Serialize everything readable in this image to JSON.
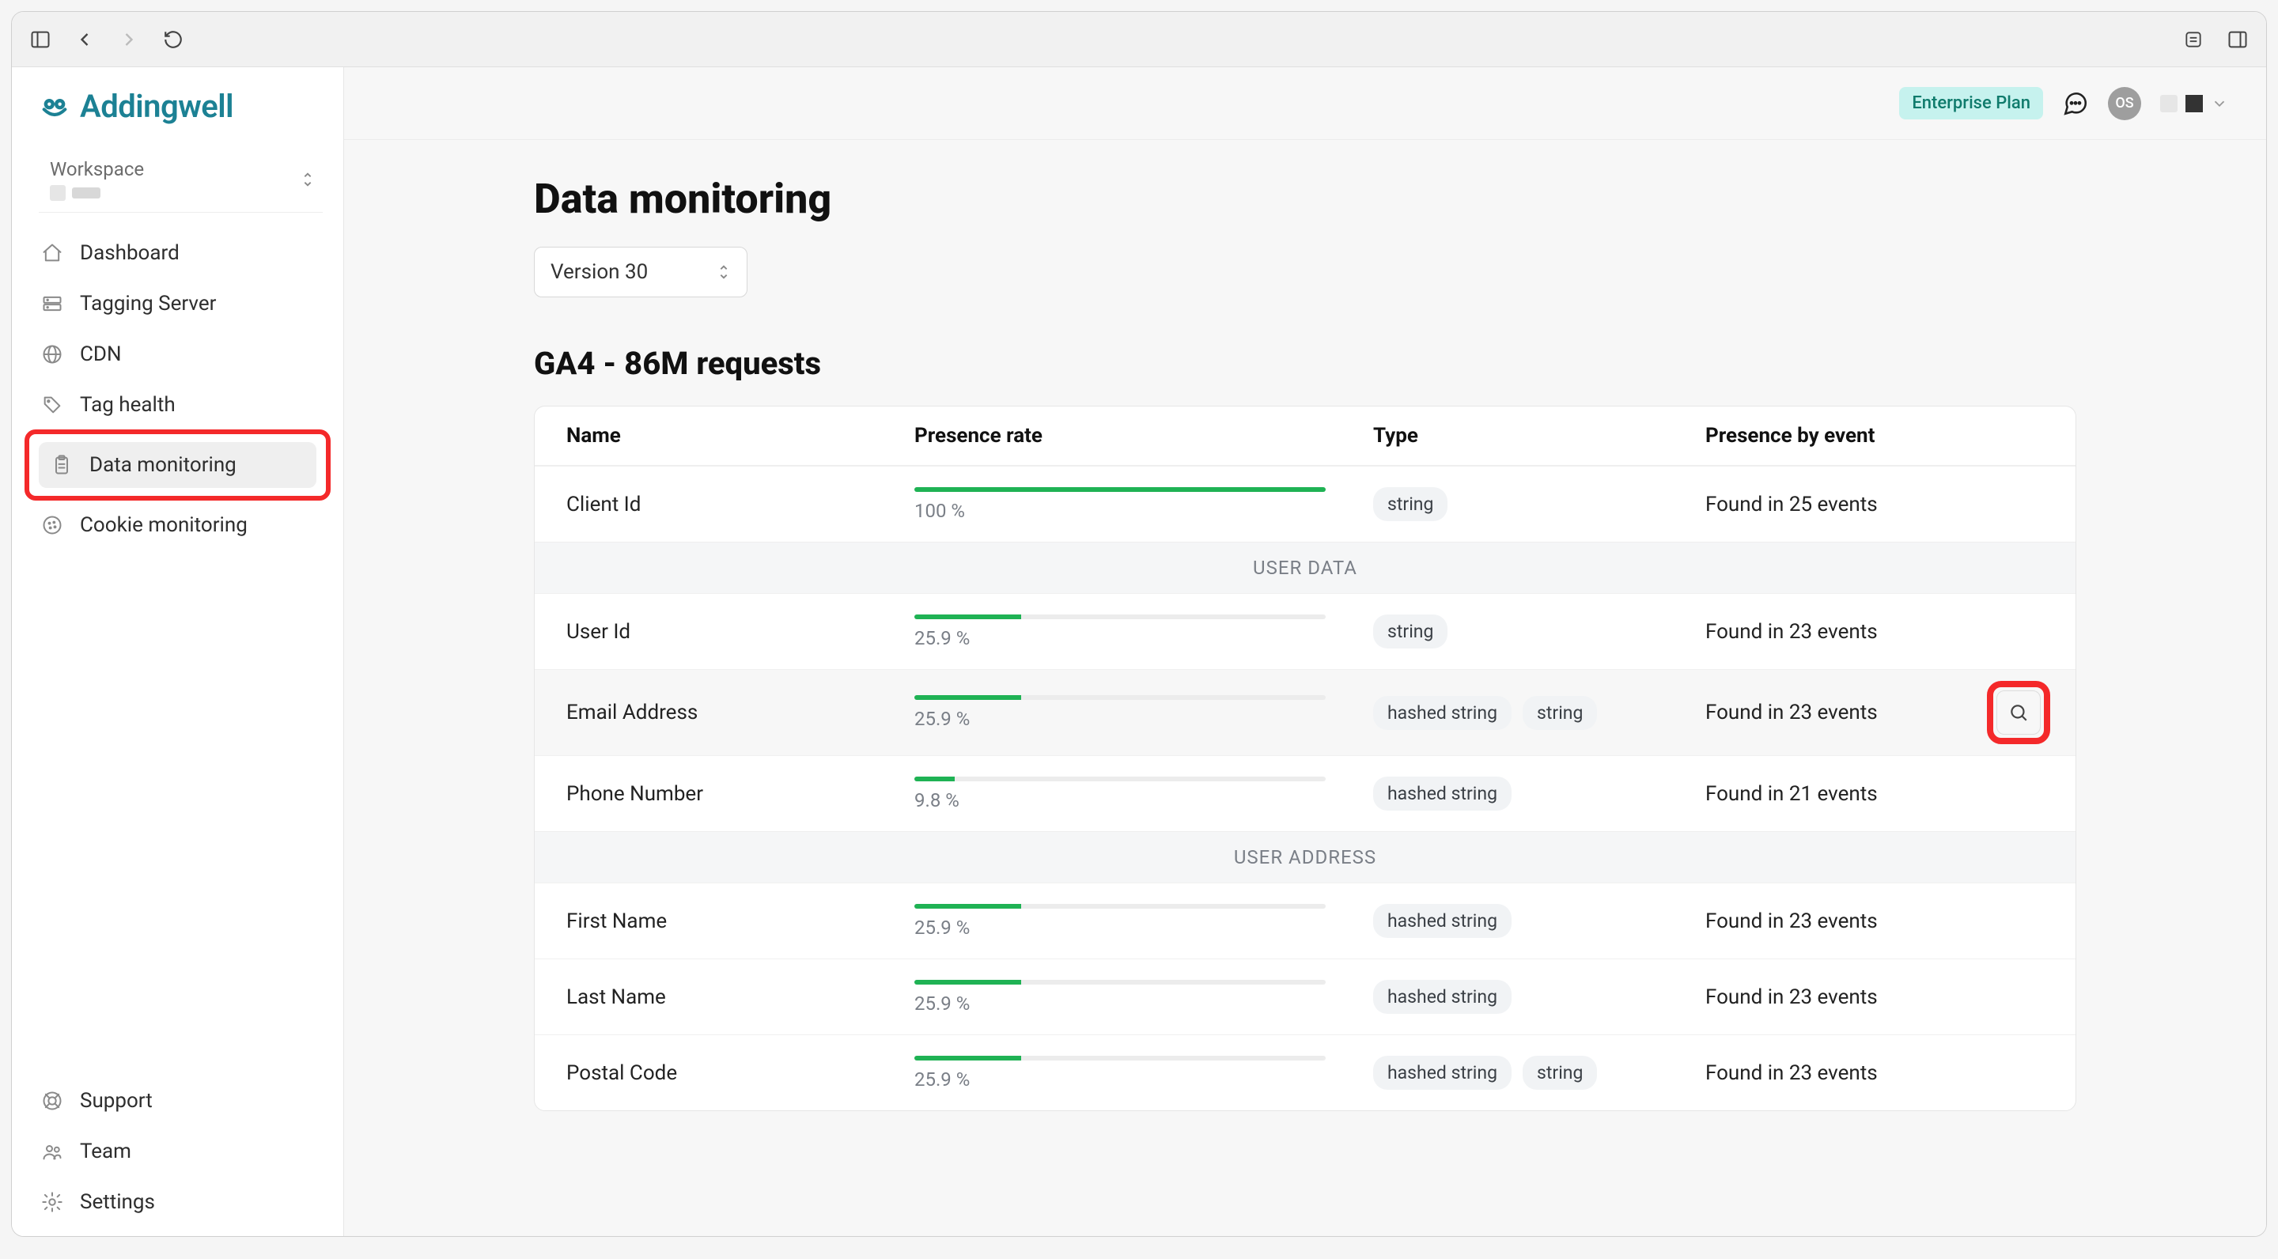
{
  "brand": "Addingwell",
  "workspace_label": "Workspace",
  "nav": {
    "items": [
      {
        "label": "Dashboard",
        "icon": "home"
      },
      {
        "label": "Tagging Server",
        "icon": "server"
      },
      {
        "label": "CDN",
        "icon": "globe"
      },
      {
        "label": "Tag health",
        "icon": "tag"
      },
      {
        "label": "Data monitoring",
        "icon": "clipboard",
        "active": true,
        "highlighted": true
      },
      {
        "label": "Cookie monitoring",
        "icon": "cookie"
      }
    ],
    "bottom": [
      {
        "label": "Support",
        "icon": "lifebuoy"
      },
      {
        "label": "Team",
        "icon": "users"
      },
      {
        "label": "Settings",
        "icon": "gear"
      }
    ]
  },
  "topbar": {
    "plan_badge": "Enterprise Plan",
    "avatar_initials": "OS"
  },
  "page": {
    "title": "Data monitoring",
    "version_selected": "Version 30",
    "section_title": "GA4 - 86M requests"
  },
  "table": {
    "columns": [
      "Name",
      "Presence rate",
      "Type",
      "Presence by event"
    ],
    "rows_before": [
      {
        "name": "Client Id",
        "pct": 100,
        "pct_label": "100 %",
        "types": [
          "string"
        ],
        "presence": "Found in 25 events"
      }
    ],
    "section1_label": "USER DATA",
    "rows_userdata": [
      {
        "name": "User Id",
        "pct": 25.9,
        "pct_label": "25.9 %",
        "types": [
          "string"
        ],
        "presence": "Found in 23 events"
      },
      {
        "name": "Email Address",
        "pct": 25.9,
        "pct_label": "25.9 %",
        "types": [
          "hashed string",
          "string"
        ],
        "presence": "Found in 23 events",
        "hovered": true,
        "search_highlighted": true
      },
      {
        "name": "Phone Number",
        "pct": 9.8,
        "pct_label": "9.8 %",
        "types": [
          "hashed string"
        ],
        "presence": "Found in 21 events"
      }
    ],
    "section2_label": "USER ADDRESS",
    "rows_useraddr": [
      {
        "name": "First Name",
        "pct": 25.9,
        "pct_label": "25.9 %",
        "types": [
          "hashed string"
        ],
        "presence": "Found in 23 events"
      },
      {
        "name": "Last Name",
        "pct": 25.9,
        "pct_label": "25.9 %",
        "types": [
          "hashed string"
        ],
        "presence": "Found in 23 events"
      },
      {
        "name": "Postal Code",
        "pct": 25.9,
        "pct_label": "25.9 %",
        "types": [
          "hashed string",
          "string"
        ],
        "presence": "Found in 23 events"
      }
    ]
  }
}
